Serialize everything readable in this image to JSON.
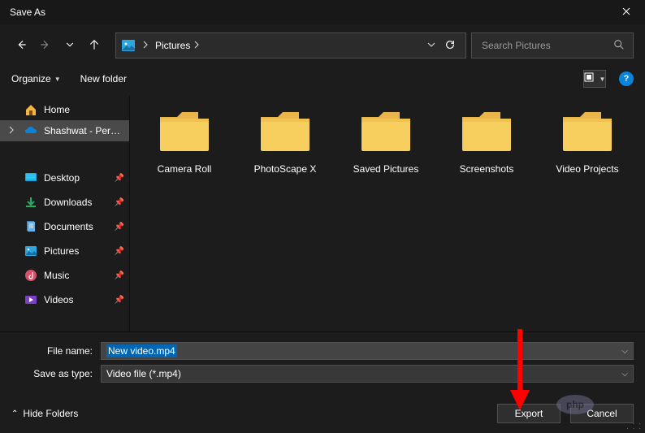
{
  "window": {
    "title": "Save As"
  },
  "nav": {
    "breadcrumb": [
      "Pictures"
    ],
    "search_placeholder": "Search Pictures"
  },
  "toolbar": {
    "organize": "Organize",
    "new_folder": "New folder"
  },
  "navpane": {
    "home": "Home",
    "onedrive": "Shashwat - Personal",
    "quick": [
      {
        "label": "Desktop",
        "icon": "desktop"
      },
      {
        "label": "Downloads",
        "icon": "downloads"
      },
      {
        "label": "Documents",
        "icon": "documents"
      },
      {
        "label": "Pictures",
        "icon": "pictures"
      },
      {
        "label": "Music",
        "icon": "music"
      },
      {
        "label": "Videos",
        "icon": "videos"
      }
    ]
  },
  "folders": [
    "Camera Roll",
    "PhotoScape X",
    "Saved Pictures",
    "Screenshots",
    "Video Projects"
  ],
  "form": {
    "filename_label": "File name:",
    "filename_value": "New video.mp4",
    "type_label": "Save as type:",
    "type_value": "Video file (*.mp4)"
  },
  "footer": {
    "hide_folders": "Hide Folders",
    "export": "Export",
    "cancel": "Cancel"
  },
  "watermark": "php"
}
